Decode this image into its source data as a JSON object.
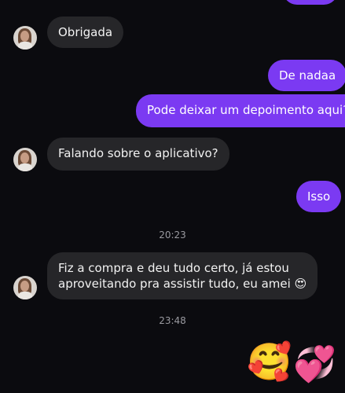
{
  "messages": [
    {
      "text": "Obrigada"
    },
    {
      "text": "De nadaa"
    },
    {
      "text": "Pode deixar um depoimento aqui?"
    },
    {
      "text": "Falando sobre o aplicativo?"
    },
    {
      "text": "Isso"
    },
    {
      "line1": "Fiz a compra e deu tudo certo, já estou",
      "line2": "aproveitando pra assistir tudo, eu amei 😍"
    }
  ],
  "timestamps": [
    "20:23",
    "23:48"
  ],
  "reactions": {
    "emoji1": "🥰",
    "emoji2": "💞"
  },
  "colors": {
    "background": "#0b0b0f",
    "incoming": "#262629",
    "outgoing": "#7b3af2"
  }
}
